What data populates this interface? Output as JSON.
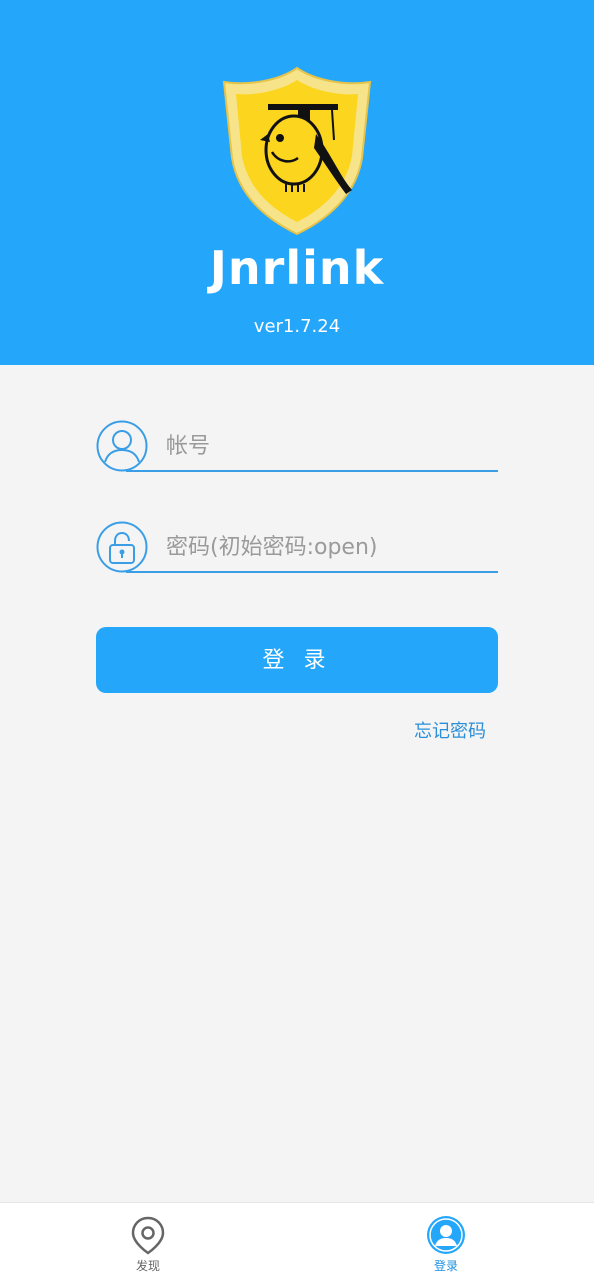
{
  "header": {
    "app_name": "Jnrlink",
    "version": "ver1.7.24",
    "logo_icon": "shield-bird-logo",
    "background_color": "#24a6fb"
  },
  "form": {
    "account": {
      "icon": "user-icon",
      "placeholder": "帐号",
      "value": ""
    },
    "password": {
      "icon": "lock-icon",
      "placeholder": "密码(初始密码:open)",
      "value": ""
    },
    "login_button_label": "登 录",
    "forgot_password_label": "忘记密码"
  },
  "bottom_nav": {
    "items": [
      {
        "label": "发现",
        "icon": "location-pin-icon",
        "active": false
      },
      {
        "label": "登录",
        "icon": "user-avatar-icon",
        "active": true
      }
    ]
  },
  "colors": {
    "accent": "#24a6fb",
    "link": "#2a8fd8",
    "background": "#f4f4f4"
  }
}
